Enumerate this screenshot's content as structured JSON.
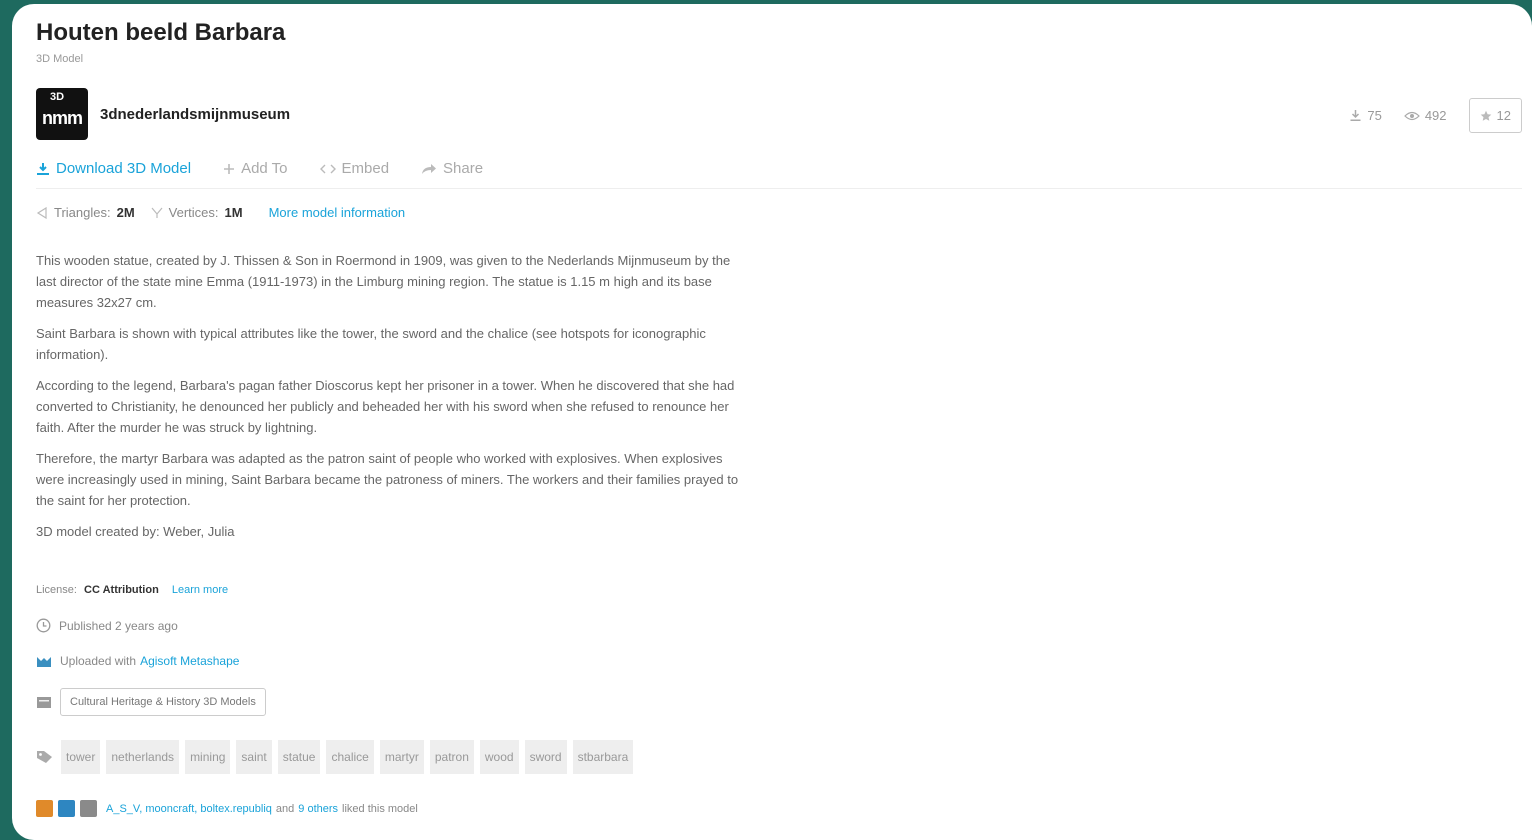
{
  "model": {
    "title": "Houten beeld Barbara",
    "type": "3D Model"
  },
  "author": {
    "avatar_top": "3D",
    "avatar_bottom": "nmm",
    "name": "3dnederlandsmijnmuseum"
  },
  "stats": {
    "downloads": "75",
    "views": "492",
    "likes": "12"
  },
  "actions": {
    "download": "Download 3D Model",
    "add_to": "Add To",
    "embed": "Embed",
    "share": "Share"
  },
  "meta": {
    "triangles_label": "Triangles:",
    "triangles_value": "2M",
    "vertices_label": "Vertices:",
    "vertices_value": "1M",
    "more_info": "More model information"
  },
  "description": [
    "This wooden statue, created by J. Thissen & Son in Roermond in 1909, was given to the Nederlands Mijnmuseum by the last director of the state mine Emma (1911-1973) in the Limburg mining region. The statue is 1.15 m high and its base measures 32x27 cm.",
    "Saint Barbara is shown with typical attributes like the tower, the sword and the chalice (see hotspots for iconographic information).",
    "According to the legend, Barbara's pagan father Dioscorus kept her prisoner in a tower. When he discovered that she had converted to Christianity, he denounced her publicly and beheaded her with his sword when she refused to renounce her faith. After the murder he was struck by lightning.",
    "Therefore, the martyr Barbara was adapted as the patron saint of people who worked with explosives. When explosives were increasingly used in mining, Saint Barbara became the patroness of miners. The workers and their families prayed to the saint for her protection.",
    "3D model created by: Weber, Julia"
  ],
  "license": {
    "label": "License:",
    "value": "CC Attribution",
    "learn_more": "Learn more"
  },
  "published": "Published 2 years ago",
  "uploaded": {
    "prefix": "Uploaded with",
    "tool": "Agisoft Metashape"
  },
  "category": "Cultural Heritage & History 3D Models",
  "tags": [
    "tower",
    "netherlands",
    "mining",
    "saint",
    "statue",
    "chalice",
    "martyr",
    "patron",
    "wood",
    "sword",
    "stbarbara"
  ],
  "liked_by": {
    "names": "A_S_V, mooncraft, boltex.republiq",
    "and": "and",
    "others": "9 others",
    "suffix": "liked this model"
  },
  "colors": {
    "accent": "#1aa3d9",
    "background": "#1e6a5f"
  }
}
